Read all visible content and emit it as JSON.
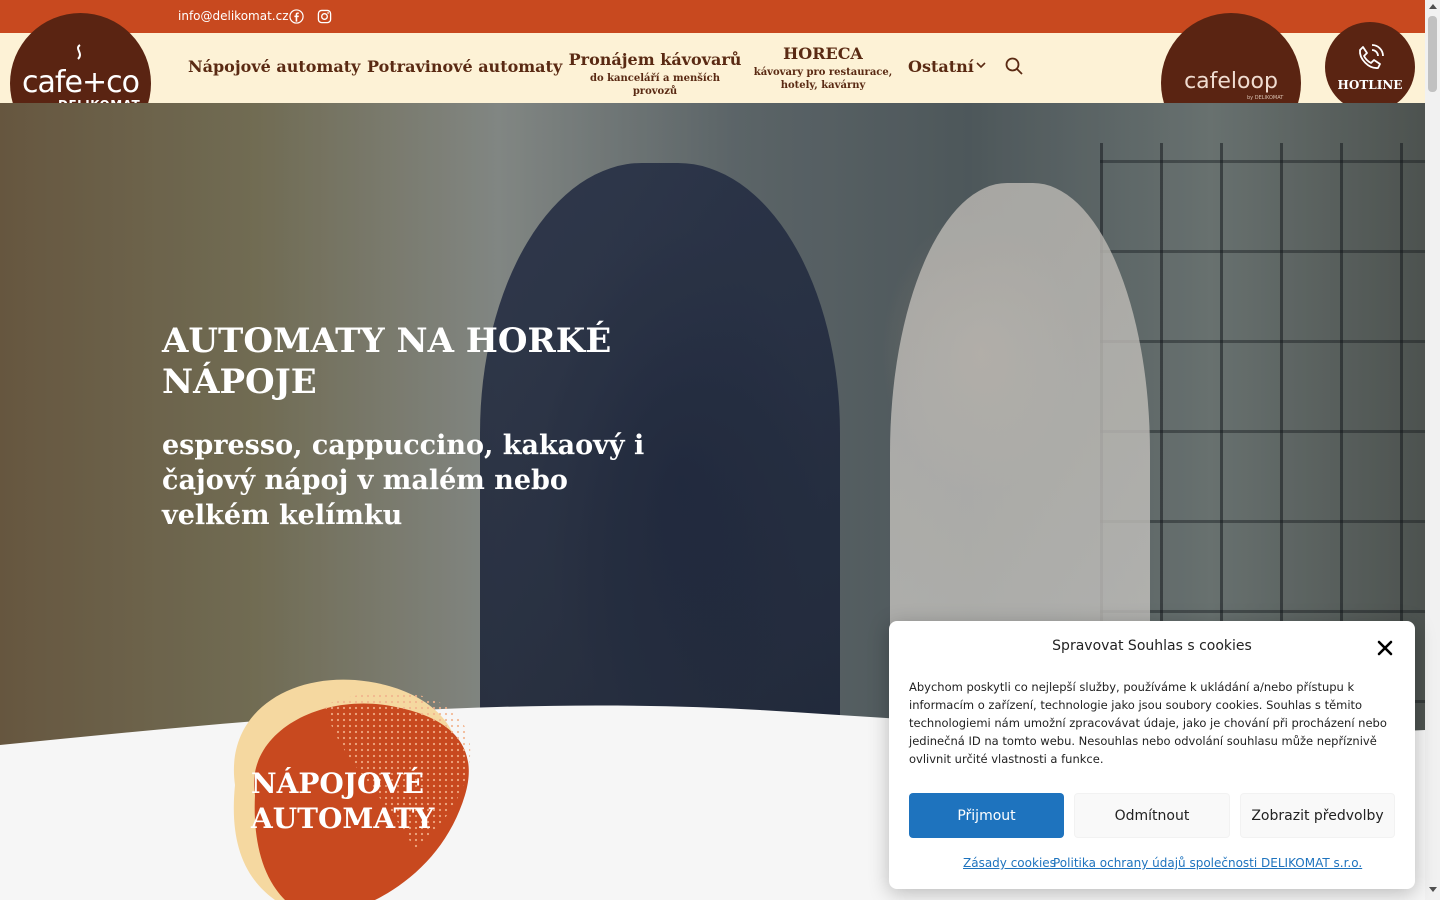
{
  "topbar": {
    "email": "info@delikomat.cz",
    "facebook_icon": "facebook-icon",
    "instagram_icon": "instagram-icon",
    "bg_color": "#c8491f"
  },
  "logo": {
    "word": "cafe+co",
    "sub": "DELIKOMAT"
  },
  "nav": {
    "items": [
      {
        "label": "Nápojové automaty",
        "sub": ""
      },
      {
        "label": "Potravinové automaty",
        "sub": ""
      },
      {
        "label": "Pronájem kávovarů",
        "sub": "do kanceláří a menších provozů"
      },
      {
        "label": "HORECA",
        "sub": "kávovary pro restaurace, hotely, kavárny"
      },
      {
        "label": "Ostatní",
        "sub": ""
      }
    ],
    "search_icon": "search-icon",
    "text_color": "#5a2a13",
    "bg_color": "#fdf2d6"
  },
  "cafeloop": {
    "word": "cafeloop",
    "sub": "by DELIKOMAT"
  },
  "hotline": {
    "label": "HOTLINE",
    "icon": "phone-icon"
  },
  "hero": {
    "title": "AUTOMATY NA HORKÉ NÁPOJE",
    "subtitle": "espresso, cappuccino, kakaový i čajový nápoj v malém nebo velkém kelímku"
  },
  "section": {
    "title_line1": "NÁPOJOVÉ",
    "title_line2": "AUTOMATY",
    "blob_color": "#c8491f",
    "blob_shadow_color": "#f5d8a0"
  },
  "cookie": {
    "title": "Spravovat Souhlas s cookies",
    "text": "Abychom poskytli co nejlepší služby, používáme k ukládání a/nebo přístupu k informacím o zařízení, technologie jako jsou soubory cookies. Souhlas s těmito technologiemi nám umožní zpracovávat údaje, jako je chování při procházení nebo jedinečná ID na tomto webu. Nesouhlas nebo odvolání souhlasu může nepříznivě ovlivnit určité vlastnosti a funkce.",
    "accept": "Přijmout",
    "deny": "Odmítnout",
    "prefs": "Zobrazit předvolby",
    "link1": "Zásady cookies",
    "link2": "Politika ochrany údajů společnosti DELIKOMAT s.r.o.",
    "accent": "#1e73be"
  }
}
